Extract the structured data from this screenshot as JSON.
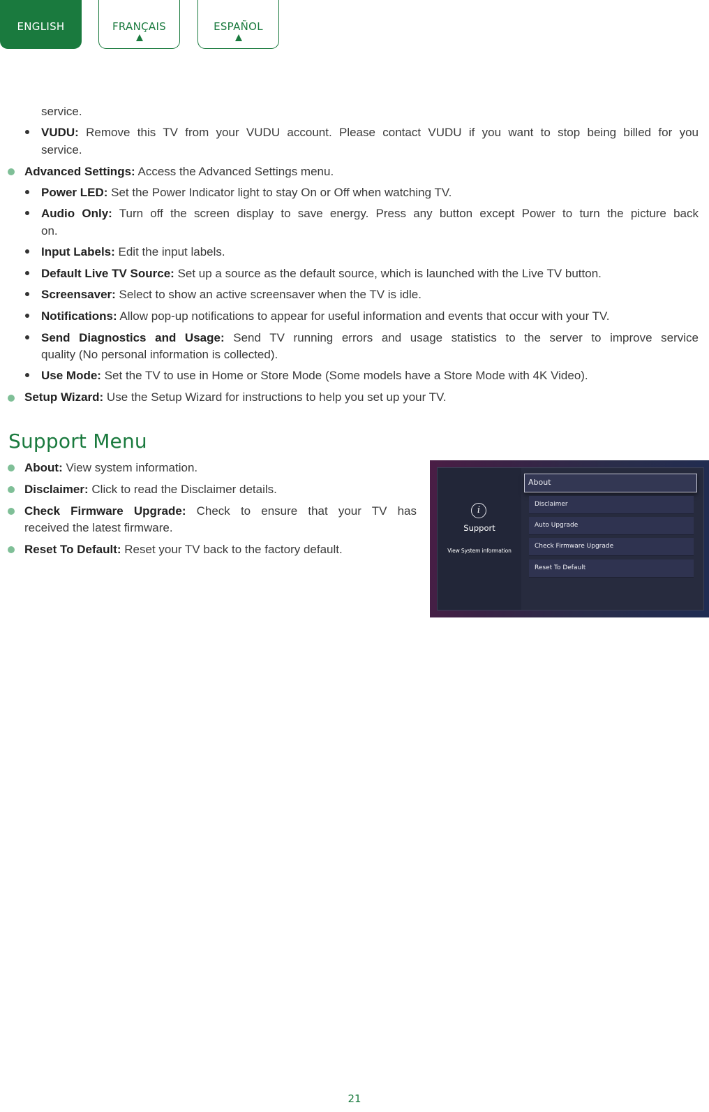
{
  "language_tabs": [
    {
      "label": "ENGLISH",
      "active": true
    },
    {
      "label": "FRANÇAIS",
      "active": false
    },
    {
      "label": "ESPAÑOL",
      "active": false
    }
  ],
  "continuation": "service.",
  "vudu": {
    "label": "VUDU:",
    "text_line1": "Remove this TV from your VUDU account. Please contact VUDU if you want to stop being billed for you",
    "text_line2": "service."
  },
  "advanced_settings": {
    "label": "Advanced Settings:",
    "text": "Access the Advanced Settings menu.",
    "items": [
      {
        "label": "Power LED:",
        "text": "Set the Power Indicator light to stay On or Off when watching TV."
      },
      {
        "label": "Audio Only:",
        "text": "Turn off the screen display to save energy. Press any button except Power to turn the picture back",
        "text2": "on."
      },
      {
        "label": "Input Labels:",
        "text": "Edit the input labels."
      },
      {
        "label": "Default Live TV Source:",
        "text": "Set up a source as the default source, which is launched with the Live TV button."
      },
      {
        "label": "Screensaver:",
        "text": "Select to show an active screensaver when the TV is idle."
      },
      {
        "label": "Notifications:",
        "text": "Allow pop-up notifications to appear for useful information and events that occur with your TV."
      },
      {
        "label": "Send Diagnostics and Usage:",
        "text": "Send TV running errors and usage statistics to the server to improve service",
        "text2": "quality (No personal information is collected)."
      },
      {
        "label": "Use Mode:",
        "text": "Set the TV to use in Home or Store Mode (Some models have a Store Mode with 4K Video)."
      }
    ]
  },
  "setup_wizard": {
    "label": "Setup Wizard:",
    "text": "Use the Setup Wizard for instructions to help you set up your TV."
  },
  "support_menu": {
    "title": "Support Menu",
    "items": [
      {
        "label": "About:",
        "text": "View system information."
      },
      {
        "label": "Disclaimer:",
        "text": "Click to read the Disclaimer details."
      },
      {
        "label": "Check Firmware Upgrade:",
        "text": "Check to ensure that your TV has",
        "text2": "received the latest firmware."
      },
      {
        "label": "Reset To Default:",
        "text": "Reset your TV back to the factory default."
      }
    ]
  },
  "tv_screen": {
    "icon": "info-icon",
    "icon_glyph": "i",
    "panel_title": "Support",
    "panel_subtitle": "View System information",
    "menu_items": [
      "About",
      "Disclaimer",
      "Auto Upgrade",
      "Check Firmware Upgrade",
      "Reset To Default"
    ],
    "selected": "About"
  },
  "page_number": "21"
}
